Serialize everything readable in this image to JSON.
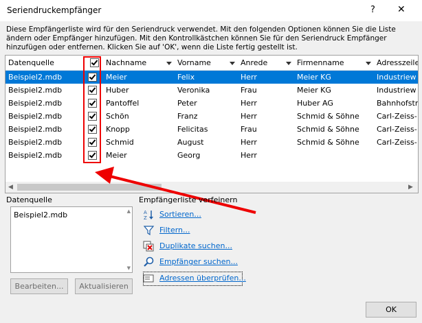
{
  "window": {
    "title": "Seriendruckempfänger",
    "help_glyph": "?",
    "close_glyph": "✕"
  },
  "description": "Diese Empfängerliste wird für den Seriendruck verwendet. Mit den folgenden Optionen können Sie die Liste ändern oder Empfänger hinzufügen. Mit den Kontrollkästchen können Sie für den Seriendruck Empfänger hinzufügen oder entfernen. Klicken Sie auf 'OK', wenn die Liste fertig gestellt ist.",
  "table": {
    "headers": [
      "Datenquelle",
      "",
      "Nachname",
      "Vorname",
      "Anrede",
      "Firmenname",
      "Adresszeile"
    ],
    "rows": [
      [
        "Beispiel2.mdb",
        "Meier",
        "Felix",
        "Herr",
        "Meier KG",
        "Industriew"
      ],
      [
        "Beispiel2.mdb",
        "Huber",
        "Veronika",
        "Frau",
        "Meier KG",
        "Industriew"
      ],
      [
        "Beispiel2.mdb",
        "Pantoffel",
        "Peter",
        "Herr",
        "Huber AG",
        "Bahnhofstr"
      ],
      [
        "Beispiel2.mdb",
        "Schön",
        "Franz",
        "Herr",
        "Schmid & Söhne",
        "Carl-Zeiss-"
      ],
      [
        "Beispiel2.mdb",
        "Knopp",
        "Felicitas",
        "Frau",
        "Schmid & Söhne",
        "Carl-Zeiss-"
      ],
      [
        "Beispiel2.mdb",
        "Schmid",
        "August",
        "Herr",
        "Schmid & Söhne",
        "Carl-Zeiss-"
      ],
      [
        "Beispiel2.mdb",
        "Meier",
        "Georg",
        "Herr",
        "",
        ""
      ]
    ],
    "selected_row": 0
  },
  "datenquelle": {
    "label": "Datenquelle",
    "items": [
      "Beispiel2.mdb"
    ],
    "edit_button": "Bearbeiten...",
    "refresh_button": "Aktualisieren"
  },
  "refine": {
    "label": "Empfängerliste verfeinern",
    "links": [
      "Sortieren...",
      "Filtern...",
      "Duplikate suchen...",
      "Empfänger suchen...",
      "Adressen überprüfen..."
    ]
  },
  "ok_button": "OK",
  "colors": {
    "selection": "#0078d7",
    "highlight": "#e00000",
    "link": "#0066cc"
  }
}
